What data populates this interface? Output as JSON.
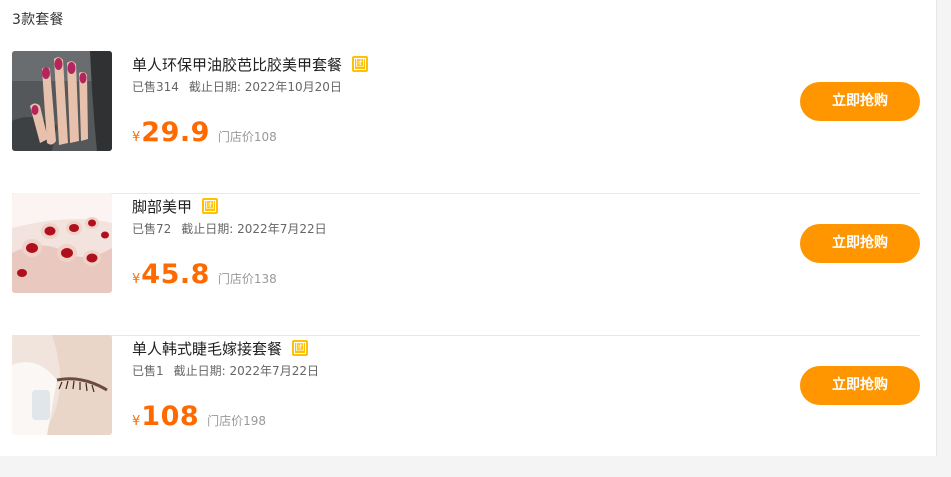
{
  "header": {
    "count_label": "3款套餐"
  },
  "items": [
    {
      "title": "单人环保甲油胶芭比胶美甲套餐",
      "badge": "团",
      "sold": "已售314",
      "deadline_label": "截止日期:",
      "deadline": "2022年10月20日",
      "currency": "¥",
      "price": "29.9",
      "original_price": "门店价108",
      "buy_label": "立即抢购",
      "image": "nail-hand-photo"
    },
    {
      "title": "脚部美甲",
      "badge": "团",
      "sold": "已售72",
      "deadline_label": "截止日期:",
      "deadline": "2022年7月22日",
      "currency": "¥",
      "price": "45.8",
      "original_price": "门店价138",
      "buy_label": "立即抢购",
      "image": "pedicure-photo"
    },
    {
      "title": "单人韩式睫毛嫁接套餐",
      "badge": "团",
      "sold": "已售1",
      "deadline_label": "截止日期:",
      "deadline": "2022年7月22日",
      "currency": "¥",
      "price": "108",
      "original_price": "门店价198",
      "buy_label": "立即抢购",
      "image": "eyelash-photo"
    }
  ],
  "colors": {
    "accent": "#ff9600",
    "price": "#ff6a00",
    "badge": "#ffc107"
  }
}
